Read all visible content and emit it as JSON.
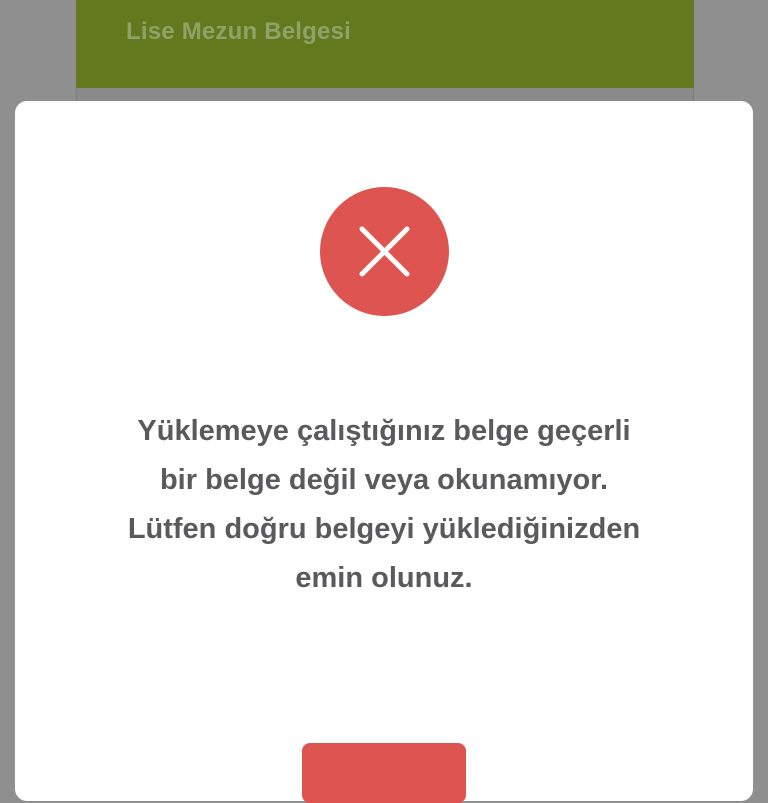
{
  "background_card": {
    "title": "Lise Mezun Belgesi",
    "header_color": "#64791e"
  },
  "modal": {
    "icon": "close-x-icon",
    "icon_color": "#dd5450",
    "message": "Yüklemeye çalıştığınız belge geçerli bir belge değil veya okunamıyor. Lütfen doğru belgeyi yüklediğinizden emin olunuz.",
    "button_color": "#dd5450"
  }
}
